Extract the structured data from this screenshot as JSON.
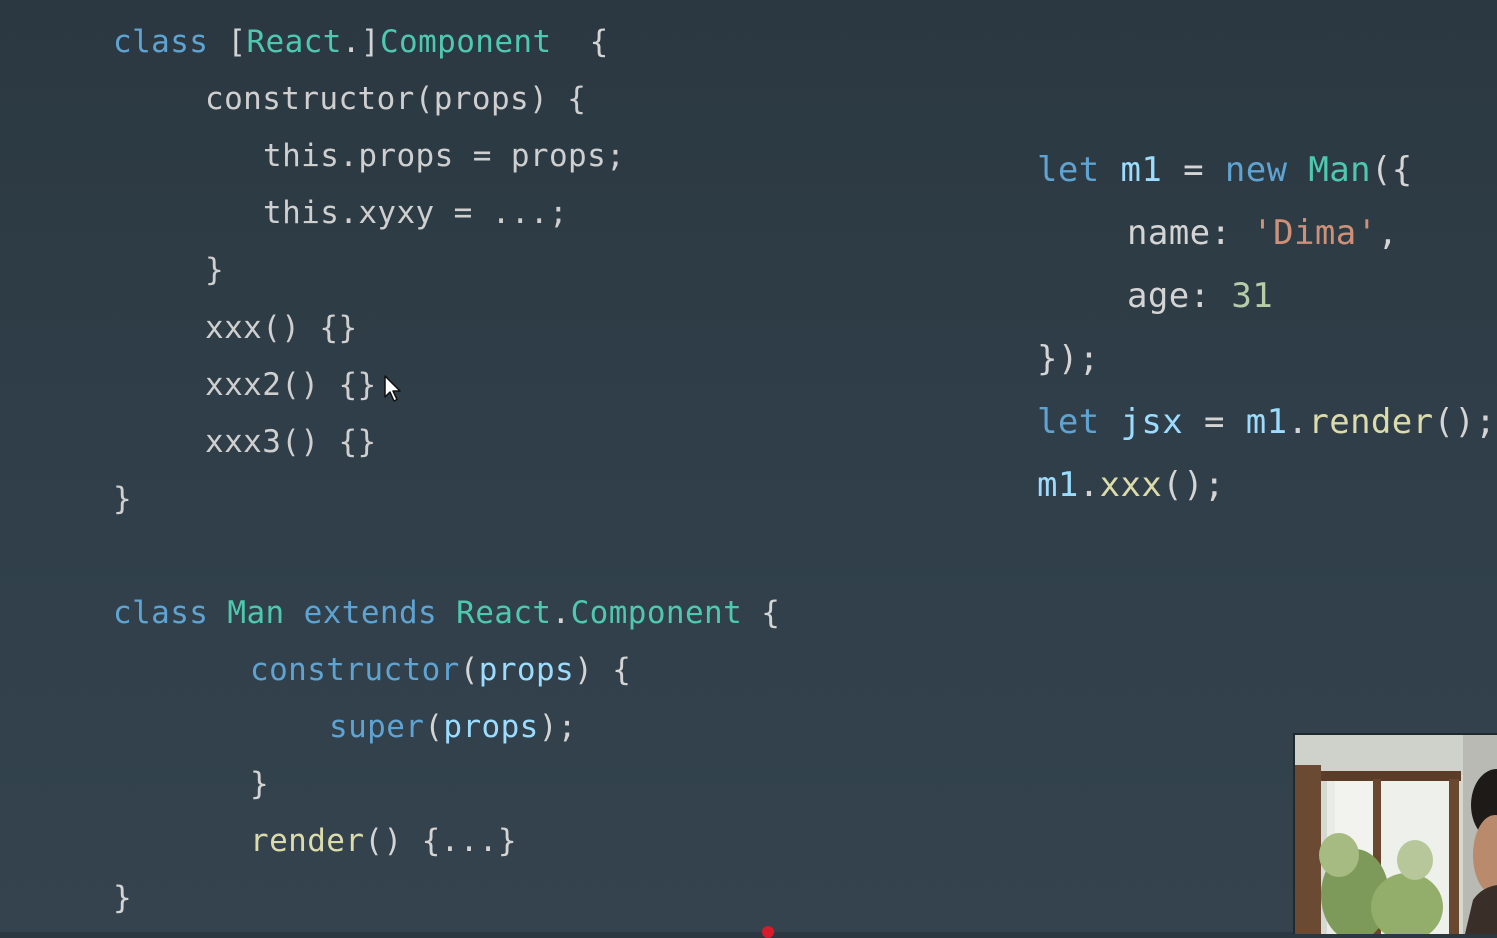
{
  "slide": {
    "left_code": [
      [
        [
          "kw",
          "class "
        ],
        [
          "pun",
          "["
        ],
        [
          "cls",
          "React"
        ],
        [
          "pun",
          "."
        ],
        [
          "pun",
          "]"
        ],
        [
          "cls",
          "Component"
        ],
        [
          "pun",
          "  {"
        ]
      ],
      [
        [
          "ret",
          "constructor(props) {"
        ]
      ],
      [
        [
          "ret",
          "this.props = props;"
        ]
      ],
      [
        [
          "ret",
          "this.xyxy = ...;"
        ]
      ],
      [
        [
          "ret",
          "}"
        ]
      ],
      [
        [
          "ret",
          "xxx() {}"
        ]
      ],
      [
        [
          "ret",
          "xxx2() {}"
        ]
      ],
      [
        [
          "ret",
          "xxx3() {}"
        ]
      ],
      [
        [
          "ret",
          "}"
        ]
      ],
      [
        [
          "kw",
          "class "
        ],
        [
          "cls",
          "Man "
        ],
        [
          "kw",
          "extends "
        ],
        [
          "cls",
          "React"
        ],
        [
          "pun",
          "."
        ],
        [
          "cls",
          "Component"
        ],
        [
          "pun",
          " {"
        ]
      ],
      [
        [
          "kw",
          "constructor"
        ],
        [
          "pun",
          "("
        ],
        [
          "var",
          "props"
        ],
        [
          "pun",
          ") {"
        ]
      ],
      [
        [
          "kw",
          "super"
        ],
        [
          "pun",
          "("
        ],
        [
          "var",
          "props"
        ],
        [
          "pun",
          ");"
        ]
      ],
      [
        [
          "pun",
          "}"
        ]
      ],
      [
        [
          "fn",
          "render"
        ],
        [
          "pun",
          "() {...}"
        ]
      ],
      [
        [
          "pun",
          "}"
        ]
      ]
    ],
    "right_code": [
      [
        [
          "kw",
          "let "
        ],
        [
          "var",
          "m1"
        ],
        [
          "pun",
          " = "
        ],
        [
          "kw",
          "new "
        ],
        [
          "cls",
          "Man"
        ],
        [
          "pun",
          "({"
        ]
      ],
      [
        [
          "plain",
          "name: "
        ],
        [
          "str",
          "'Dima'"
        ],
        [
          "pun",
          ","
        ]
      ],
      [
        [
          "plain",
          "age: "
        ],
        [
          "num",
          "31"
        ]
      ],
      [
        [
          "pun",
          "});"
        ]
      ],
      [
        [
          "kw",
          "let "
        ],
        [
          "var",
          "jsx"
        ],
        [
          "pun",
          " = "
        ],
        [
          "var",
          "m1"
        ],
        [
          "pun",
          "."
        ],
        [
          "fn",
          "render"
        ],
        [
          "pun",
          "();"
        ]
      ],
      [
        [
          "var",
          "m1"
        ],
        [
          "pun",
          "."
        ],
        [
          "fn",
          "xxx"
        ],
        [
          "pun",
          "();"
        ]
      ]
    ]
  },
  "overlay": {
    "pointer_icon": "mouse-pointer-icon",
    "webcam": "presenter-webcam",
    "recording_dot_color": "#d81b2b"
  }
}
